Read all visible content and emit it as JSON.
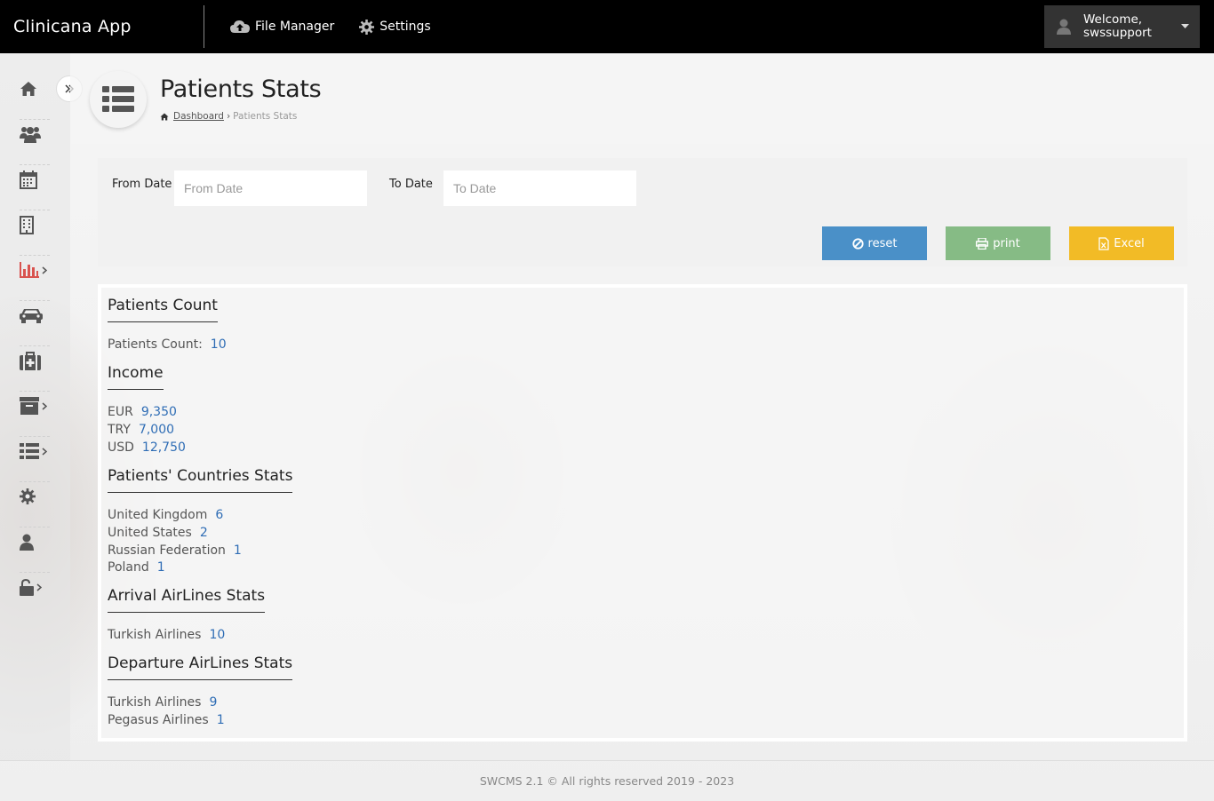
{
  "app": {
    "brand": "Clinicana App"
  },
  "topnav": {
    "file_manager": "File Manager",
    "settings": "Settings"
  },
  "user": {
    "welcome": "Welcome,",
    "username": "swssupport"
  },
  "header": {
    "title": "Patients Stats",
    "breadcrumb_home": "Dashboard",
    "breadcrumb_current": "Patients Stats"
  },
  "filters": {
    "from_label": "From Date",
    "from_placeholder": "From Date",
    "to_label": "To Date",
    "to_placeholder": "To Date"
  },
  "buttons": {
    "reset": "reset",
    "print": "print",
    "excel": "Excel"
  },
  "stats": {
    "patients_count_title": "Patients Count",
    "patients_count_label": "Patients Count:",
    "patients_count_value": "10",
    "income_title": "Income",
    "income": [
      {
        "currency": "EUR",
        "value": "9,350"
      },
      {
        "currency": "TRY",
        "value": "7,000"
      },
      {
        "currency": "USD",
        "value": "12,750"
      }
    ],
    "countries_title": "Patients' Countries Stats",
    "countries": [
      {
        "name": "United Kingdom",
        "value": "6"
      },
      {
        "name": "United States",
        "value": "2"
      },
      {
        "name": "Russian Federation",
        "value": "1"
      },
      {
        "name": "Poland",
        "value": "1"
      }
    ],
    "arrival_title": "Arrival AirLines Stats",
    "arrival": [
      {
        "name": "Turkish Airlines",
        "value": "10"
      }
    ],
    "departure_title": "Departure AirLines Stats",
    "departure": [
      {
        "name": "Turkish Airlines",
        "value": "9"
      },
      {
        "name": "Pegasus Airlines",
        "value": "1"
      }
    ]
  },
  "footer": {
    "text": "SWCMS 2.1 © All rights reserved 2019 - 2023"
  },
  "sidebar_icons": [
    "home-icon",
    "users-icon",
    "calendar-icon",
    "building-icon",
    "bar-chart-icon",
    "car-icon",
    "medkit-icon",
    "archive-icon",
    "list-icon",
    "gear-icon",
    "user-icon",
    "unlock-icon"
  ],
  "colors": {
    "accent_red": "#d9534f",
    "link_blue": "#2f6db5",
    "reset": "#4a90c8",
    "print": "#86bb85",
    "excel": "#f2bb26"
  }
}
